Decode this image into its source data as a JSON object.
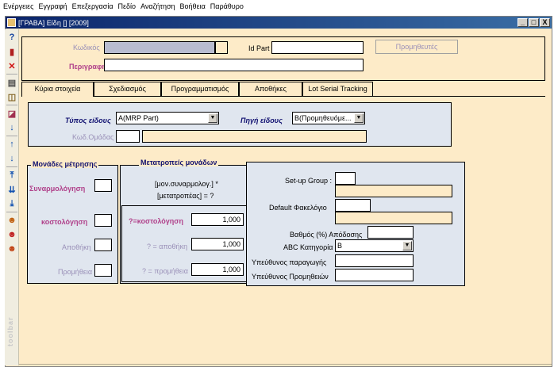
{
  "menubar": {
    "items": [
      "Ενέργειες",
      "Εγγραφή",
      "Επεξεργασία",
      "Πεδίο",
      "Αναζήτηση",
      "Βοήθεια",
      "Παράθυρο"
    ]
  },
  "window": {
    "title": "[ΓΡΑΒΑ] Είδη [] [2009]",
    "min_label": "_",
    "max_label": "□",
    "close_label": "X"
  },
  "toolbar": {
    "label": "toolbar",
    "buttons": [
      "help-icon",
      "book-icon",
      "delete-icon",
      "print-icon",
      "open-book-icon",
      "eraser-icon",
      "arrow-down-icon",
      "arrow-up-icon",
      "arrow-down-icon",
      "first-record-icon",
      "next-block-icon",
      "last-record-icon",
      "user-icon",
      "user-delete-icon",
      "user-edit-icon"
    ]
  },
  "header": {
    "code_label": "Κωδικός",
    "code_value": "",
    "idpart_label": "Id Part",
    "idpart_value": "",
    "suppliers_button": "Προμηθευτές",
    "description_label": "Περιγραφή",
    "description_value": ""
  },
  "tabs": [
    {
      "label": "Κύρια στοιχεία",
      "active": true
    },
    {
      "label": "Σχεδιασμός",
      "active": false
    },
    {
      "label": "Προγραμματισμός",
      "active": false
    },
    {
      "label": "Αποθήκες",
      "active": false
    },
    {
      "label": "Lot Serial Tracking",
      "active": false
    }
  ],
  "main": {
    "item_type_label": "Τύπος είδους",
    "item_type_value": "A(MRP Part)",
    "item_source_label": "Πηγή είδους",
    "item_source_value": "B(Προμηθευόμε...",
    "group_code_label": "Κωδ.Ομάδας",
    "group_code_value": "",
    "group_desc_value": ""
  },
  "units": {
    "title": "Μονάδες μέτρησης",
    "assembly_label": "Συναρμολόγηση",
    "costing_label": "κοστολόγηση",
    "warehouse_label": "Αποθήκη",
    "supply_label": "Προμήθεια"
  },
  "conversions": {
    "title": "Μετατροπείς μονάδων",
    "formula_line1": "[μον.συναρμολογ.] *",
    "formula_line2": "[μετατροπέας] = ?",
    "costing_label": "?=κοστολόγηση",
    "costing_value": "1,000",
    "warehouse_label": "? = αποθήκη",
    "warehouse_value": "1,000",
    "supply_label": "? = προμήθεια",
    "supply_value": "1,000"
  },
  "settings": {
    "setup_group_label": "Set-up Group :",
    "setup_group_value": "",
    "default_folder_label": "Default Φακελόγιο",
    "default_folder_value": "",
    "yield_label": "Βαθμός (%) Απόδοσης",
    "yield_value": "",
    "abc_label": "ABC Κατηγορία",
    "abc_value": "B",
    "production_resp_label": "Υπεύθυνος παραγωγής",
    "production_resp_value": "",
    "procurement_resp_label": "Υπεύθυνος Προμηθειών",
    "procurement_resp_value": ""
  }
}
